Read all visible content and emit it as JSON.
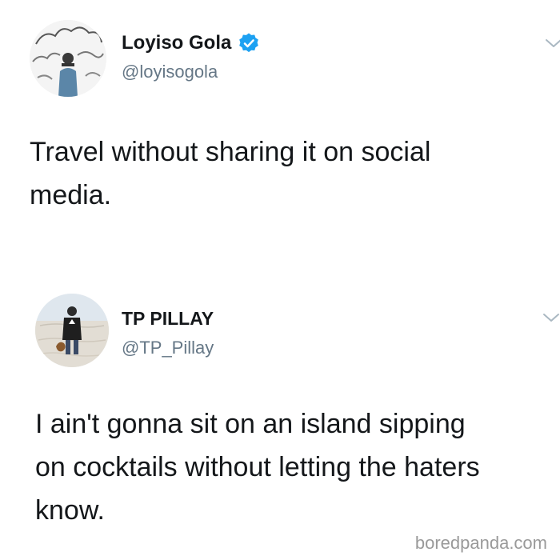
{
  "tweets": [
    {
      "display_name": "Loyiso Gola",
      "verified": true,
      "handle": "@loyisogola",
      "text_lines": [
        "Travel without sharing it on social",
        "media."
      ]
    },
    {
      "display_name": "TP PILLAY",
      "verified": false,
      "handle": "@TP_Pillay",
      "text_lines": [
        "I ain't gonna sit on an island sipping",
        "on cocktails without letting the haters",
        "know."
      ]
    }
  ],
  "watermark": "boredpanda.com",
  "colors": {
    "text": "#14171a",
    "handle": "#657786",
    "verified_badge": "#1da1f2",
    "chevron": "#aab8c2",
    "watermark": "#9a9a9a"
  },
  "icons": {
    "verified": "verified-badge-icon",
    "menu": "chevron-down-icon"
  }
}
